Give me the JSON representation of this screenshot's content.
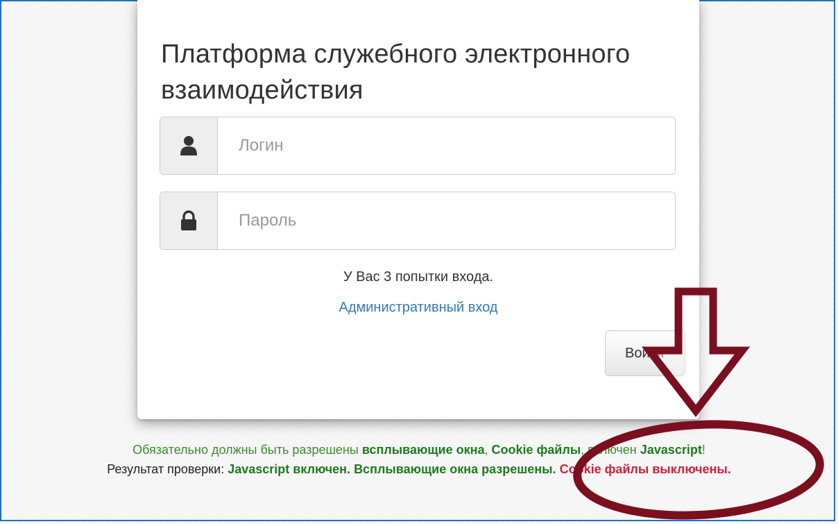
{
  "login_form": {
    "title": "Платформа служебного электронного взаимодействия",
    "login_placeholder": "Логин",
    "password_placeholder": "Пароль",
    "attempts_text": "У Вас 3 попытки входа.",
    "admin_link": "Административный вход",
    "submit_label": "Войти",
    "icons": {
      "login": "user-icon",
      "password": "lock-icon"
    }
  },
  "requirements": {
    "prefix": "Обязательно должны быть разрешены",
    "popups": "всплывающие окна",
    "comma1": ",",
    "cookies": "Cookie файлы",
    "middle": ", включен",
    "javascript": "Javascript",
    "suffix": "!"
  },
  "check_result": {
    "label": "Результат проверки:",
    "js_status": "Javascript включен.",
    "popups_status": "Всплывающие окна разрешены.",
    "cookie_status": "Cookie файлы выключены."
  },
  "colors": {
    "frame": "#1f6fc4",
    "link": "#337ab7",
    "ok_green": "#1e7a1e",
    "error_red": "#d0223d",
    "annotation_maroon": "#7a0f20"
  }
}
